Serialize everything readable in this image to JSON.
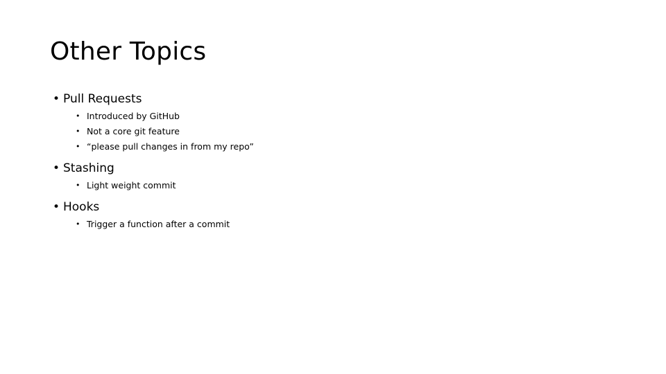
{
  "slide": {
    "title": "Other Topics",
    "background_color": "#ffffff",
    "text_color": "#000000",
    "bullet_glyph_level1": "•",
    "bullet_glyph_level2": "•",
    "outline": [
      {
        "label": "Pull Requests",
        "children": [
          {
            "label": "Introduced by GitHub"
          },
          {
            "label": "Not a core git feature"
          },
          {
            "label": "“please pull changes in from my repo”"
          }
        ]
      },
      {
        "label": "Stashing",
        "children": [
          {
            "label": "Light weight commit"
          }
        ]
      },
      {
        "label": "Hooks",
        "children": [
          {
            "label": "Trigger a function after a commit"
          }
        ]
      }
    ]
  }
}
